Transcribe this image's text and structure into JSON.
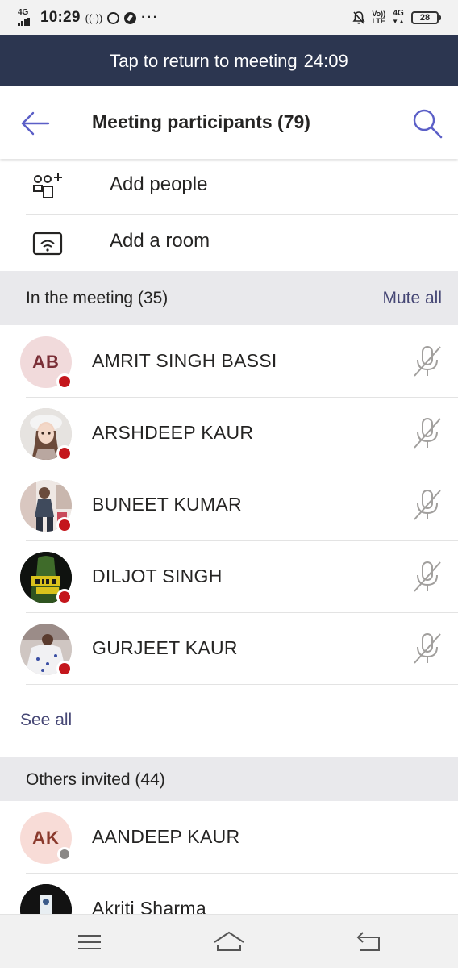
{
  "status_bar": {
    "network_type": "4G",
    "time": "10:29",
    "extra_icons": [
      "hotspot-icon",
      "whatsapp-icon",
      "compass-icon"
    ],
    "more_dots": "···",
    "volte_label_top": "Vo))",
    "volte_label_bottom": "LTE",
    "network_right": "4G",
    "battery_level": "28"
  },
  "banner": {
    "label": "Tap to return to meeting",
    "timer": "24:09"
  },
  "header": {
    "title": "Meeting participants (79)",
    "back_icon": "arrow-left-icon",
    "search_icon": "search-icon"
  },
  "actions": [
    {
      "label": "Add people",
      "icon": "add-people-icon"
    },
    {
      "label": "Add a room",
      "icon": "room-cast-icon"
    }
  ],
  "in_meeting": {
    "title": "In the meeting (35)",
    "action_label": "Mute all",
    "see_all_label": "See all",
    "participants": [
      {
        "name": "AMRIT SINGH BASSI",
        "initials": "AB",
        "avatar": "initials",
        "status": "busy",
        "muted": true
      },
      {
        "name": "ARSHDEEP KAUR",
        "initials": "",
        "avatar": "photo",
        "status": "busy",
        "muted": true
      },
      {
        "name": "BUNEET KUMAR",
        "initials": "",
        "avatar": "photo",
        "status": "busy",
        "muted": true
      },
      {
        "name": "DILJOT SINGH",
        "initials": "",
        "avatar": "photo",
        "status": "busy",
        "muted": true
      },
      {
        "name": "GURJEET KAUR",
        "initials": "",
        "avatar": "photo",
        "status": "busy",
        "muted": true
      }
    ]
  },
  "others_invited": {
    "title": "Others invited (44)",
    "participants": [
      {
        "name": "AANDEEP KAUR",
        "initials": "AK",
        "avatar": "initials",
        "status": "offline"
      },
      {
        "name": "Akriti Sharma",
        "initials": "",
        "avatar": "photo",
        "status": "none"
      }
    ]
  },
  "colors": {
    "banner_bg": "#2c3650",
    "accent": "#464775",
    "busy": "#c4161c",
    "offline": "#8a8886",
    "section_bg": "#e9e9ec"
  },
  "nav": [
    "menu-icon",
    "home-icon",
    "back-icon"
  ]
}
